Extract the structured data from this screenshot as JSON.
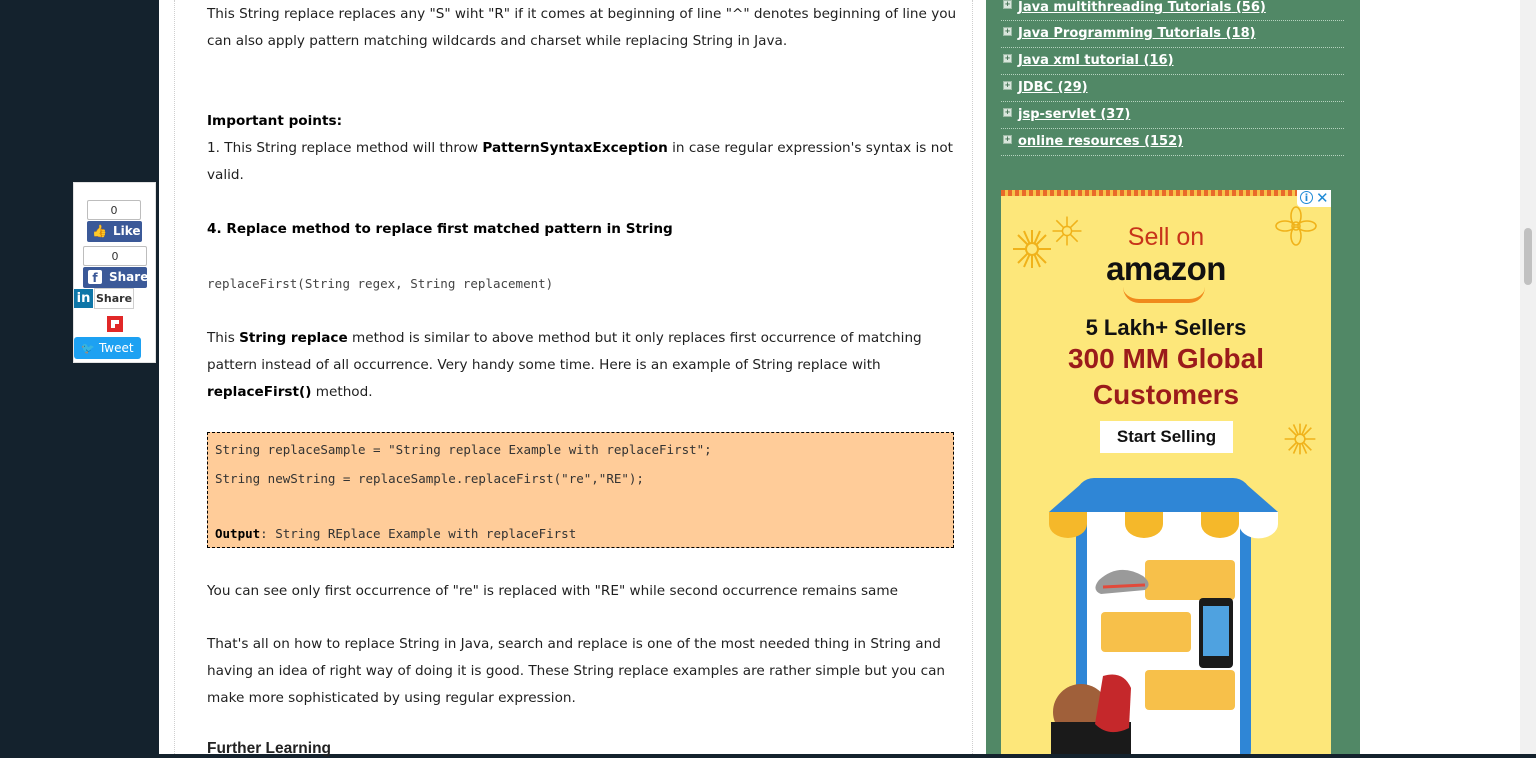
{
  "article": {
    "para1": "This String replace replaces any \"S\" wiht \"R\" if it comes at beginning of line \"^\" denotes beginning of line you can also apply pattern matching wildcards and charset while replacing String in Java.",
    "important_heading": "Important points:",
    "point1_prefix": "1. This String replace method will throw ",
    "point1_bold": "PatternSyntaxException",
    "point1_suffix": " in case regular expression's syntax is not valid.",
    "section4_heading": "4. Replace method to replace first matched pattern in String",
    "signature": "replaceFirst(String regex, String replacement)",
    "para2_a": "This ",
    "para2_bold1": "String replace",
    "para2_b": " method is similar to above method but it only replaces first occurrence of matching pattern instead of all occurrence. Very handy some time. Here is an example of String replace with ",
    "para2_bold2": "replaceFirst()",
    "para2_c": " method.",
    "code_line1": "String replaceSample = \"String replace Example with replaceFirst\";",
    "code_line2": "String newString = replaceSample.replaceFirst(\"re\",\"RE\");",
    "output_label": "Output",
    "output_text": ": String REplace Example with replaceFirst",
    "para3": "You can see only first occurrence of \"re\" is replaced with \"RE\" while second occurrence remains same",
    "para4": "That's all on how to replace String in Java, search and replace is one of the most needed thing in String and having an idea of right way of doing it is good. These String replace examples are rather simple but you can make more sophisticated by using regular expression.",
    "further_heading": "Further Learning"
  },
  "sidebar": {
    "labels": [
      {
        "name": "Java multithreading Tutorials",
        "count": "(56)"
      },
      {
        "name": "Java Programming Tutorials",
        "count": "(18)"
      },
      {
        "name": "Java xml tutorial",
        "count": "(16)"
      },
      {
        "name": "JDBC",
        "count": "(29)"
      },
      {
        "name": "jsp-servlet",
        "count": "(37)"
      },
      {
        "name": "online resources",
        "count": "(152)"
      }
    ]
  },
  "ad": {
    "sell_on": "Sell on",
    "brand": "amazon",
    "sellers": "5 Lakh+ Sellers",
    "global_line1": "300 MM Global",
    "global_line2": "Customers",
    "cta": "Start Selling",
    "info_icon": "info-icon",
    "close_icon": "close-icon"
  },
  "share": {
    "fb_like_count": "0",
    "fb_like_label": "Like",
    "fb_share_count": "0",
    "fb_share_label": "Share",
    "linkedin_logo": "in",
    "linkedin_label": "Share",
    "tweet_label": "Tweet"
  },
  "colors": {
    "page_bg": "#14222d",
    "sidebar_bg": "#518866",
    "code_bg": "#ffcc99",
    "facebook": "#3b5998",
    "twitter": "#1da1f2",
    "linkedin": "#0e76a8"
  }
}
